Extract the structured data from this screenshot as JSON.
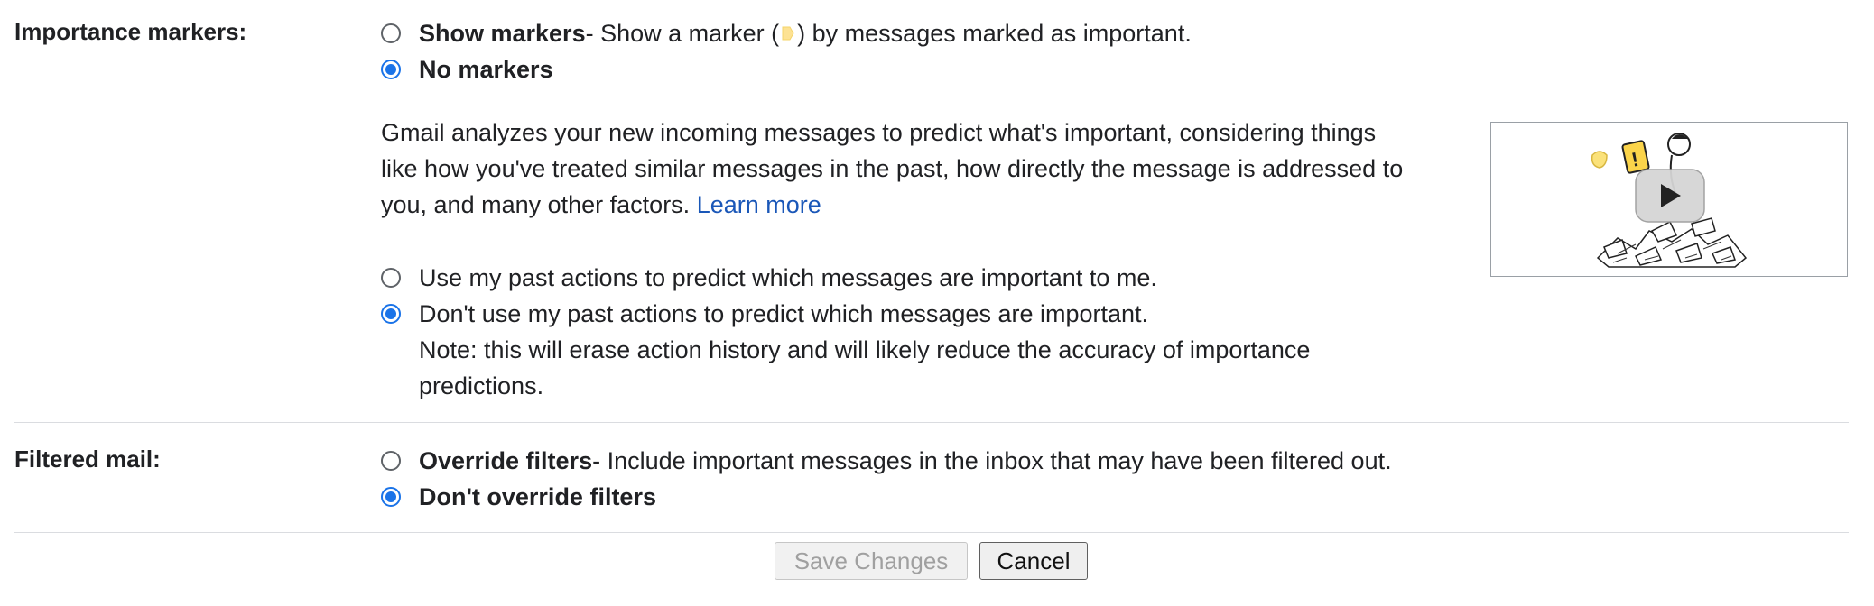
{
  "importance": {
    "label": "Importance markers:",
    "show_markers": {
      "title": "Show markers",
      "desc_before": " - Show a marker (",
      "desc_after": ") by messages marked as important.",
      "checked": false
    },
    "no_markers": {
      "title": "No markers",
      "checked": true
    },
    "paragraph": "Gmail analyzes your new incoming messages to predict what's important, considering things like how you've treated similar messages in the past, how directly the message is addressed to you, and many other factors. ",
    "learn_more": "Learn more",
    "use_past": {
      "text": "Use my past actions to predict which messages are important to me.",
      "checked": false
    },
    "dont_use_past": {
      "text": "Don't use my past actions to predict which messages are important.",
      "checked": true
    },
    "note": "Note: this will erase action history and will likely reduce the accuracy of importance predictions."
  },
  "filtered": {
    "label": "Filtered mail:",
    "override": {
      "title": "Override filters",
      "desc": " - Include important messages in the inbox that may have been filtered out.",
      "checked": false
    },
    "dont_override": {
      "title": "Don't override filters",
      "checked": true
    }
  },
  "buttons": {
    "save": "Save Changes",
    "cancel": "Cancel"
  },
  "colors": {
    "accent": "#1a73e8",
    "link": "#1a57b8",
    "marker": "#fde293"
  }
}
